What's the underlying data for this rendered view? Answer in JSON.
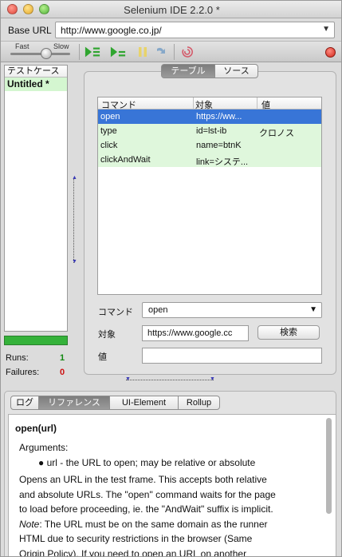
{
  "window": {
    "title": "Selenium IDE 2.2.0 *"
  },
  "base_url": {
    "label": "Base URL",
    "value": "http://www.google.co.jp/"
  },
  "toolbar": {
    "speed_fast": "Fast",
    "speed_slow": "Slow",
    "icons": [
      "play-all-icon",
      "play-current-icon",
      "pause-icon",
      "step-icon",
      "rollup-icon",
      "record-icon"
    ]
  },
  "test_cases": {
    "header": "テストケース",
    "items": [
      "Untitled *"
    ]
  },
  "stats": {
    "runs_label": "Runs:",
    "runs_value": "1",
    "failures_label": "Failures:",
    "failures_value": "0",
    "progress": 1.0
  },
  "editor": {
    "tabs": [
      "テーブル",
      "ソース"
    ],
    "active_tab": "テーブル",
    "columns": [
      "コマンド",
      "対象",
      "値"
    ],
    "rows": [
      {
        "command": "open",
        "target": "https://ww...",
        "value": ""
      },
      {
        "command": "type",
        "target": "id=lst-ib",
        "value": "クロノス"
      },
      {
        "command": "click",
        "target": "name=btnK",
        "value": ""
      },
      {
        "command": "clickAndWait",
        "target": "link=システ...",
        "value": ""
      }
    ],
    "command_label": "コマンド",
    "command_value": "open",
    "target_label": "対象",
    "target_value": "https://www.google.cc",
    "find_button": "検索",
    "value_label": "値",
    "value_value": ""
  },
  "bottom": {
    "tabs": [
      "ログ",
      "リファレンス",
      "UI-Element",
      "Rollup"
    ],
    "active_tab": "リファレンス",
    "ref_title": "open(url)",
    "ref_args": "Arguments:",
    "ref_bullet": "url - the URL to open; may be relative or absolute",
    "ref_line1": "Opens an URL in the test frame. This accepts both relative",
    "ref_line2": "and absolute URLs. The \"open\" command waits for the page",
    "ref_line3": "to load before proceeding, ie. the \"AndWait\" suffix is implicit.",
    "ref_note": "Note",
    "ref_line4": ": The URL must be on the same domain as the runner",
    "ref_line5": "HTML due to security restrictions in the browser (Same",
    "ref_line6": "Origin Policy). If you need to open an URL on another"
  },
  "colors": {
    "selected_row": "#3875d7",
    "row_green": "#dff7dc",
    "progress_green": "#35b23a",
    "failures_red": "#cc1111",
    "runs_green": "#118811"
  }
}
